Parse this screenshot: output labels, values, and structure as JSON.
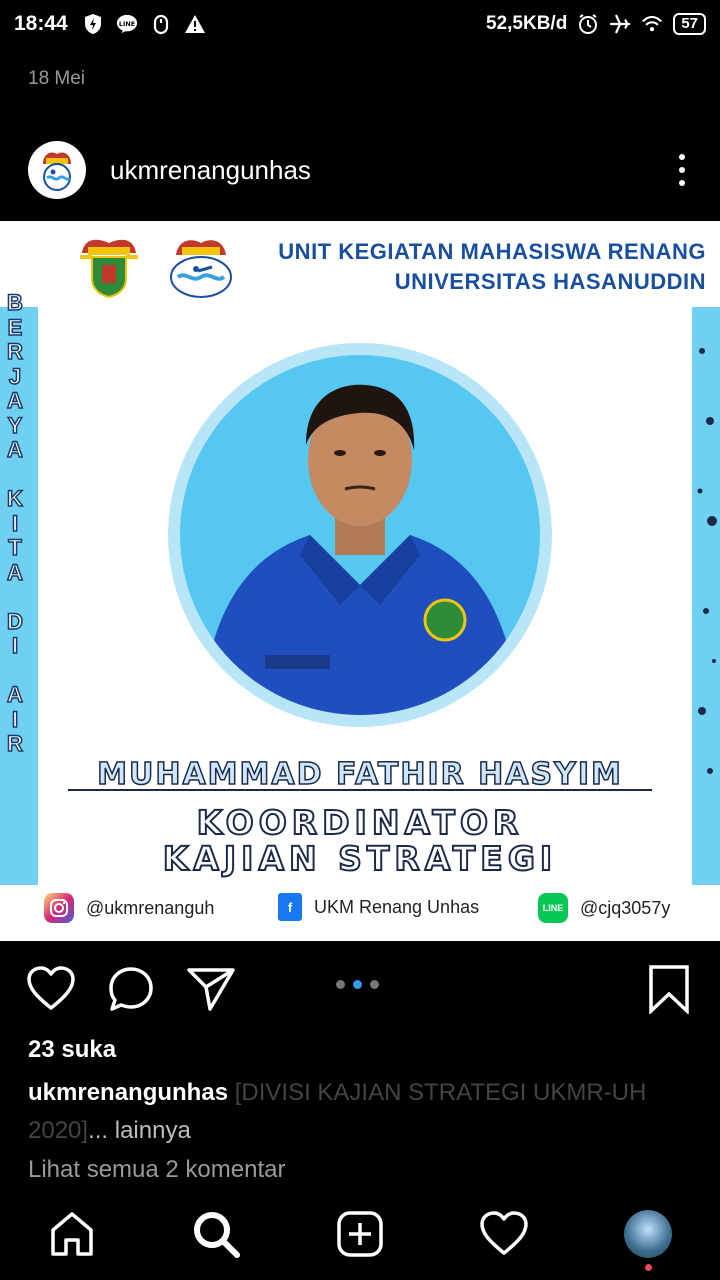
{
  "status_bar": {
    "time": "18:44",
    "network_speed": "52,5KB/d",
    "battery": "57"
  },
  "date_text": "18 Mei",
  "post": {
    "username": "ukmrenangunhas",
    "image": {
      "org_line1": "UNIT KEGIATAN MAHASISWA RENANG",
      "org_line2": "UNIVERSITAS HASANUDDIN",
      "vertical_motto": [
        "B",
        "E",
        "R",
        "J",
        "A",
        "Y",
        "A",
        " ",
        "K",
        "I",
        "T",
        "A",
        " ",
        "D",
        "I",
        " ",
        "A",
        "I",
        "R"
      ],
      "name": "MUHAMMAD FATHIR HASYIM",
      "role_line1": "KOORDINATOR",
      "role_line2": "KAJIAN STRATEGI",
      "socials": {
        "instagram": "@ukmrenanguh",
        "facebook": "UKM Renang Unhas",
        "line": "@cjq3057y"
      }
    },
    "likes": "23 suka",
    "caption_user": "ukmrenangunhas",
    "caption_text": "[DIVISI KAJIAN STRATEGI UKMR-UH 2020]",
    "caption_more": "... lainnya",
    "comments_link": "Lihat semua 2 komentar",
    "carousel": {
      "count": 3,
      "active_index": 1
    }
  },
  "colors": {
    "accent": "#3897f0",
    "frame_blue": "#6fd0f2",
    "title_blue": "#1a4fa0",
    "notification": "#ed4956"
  }
}
